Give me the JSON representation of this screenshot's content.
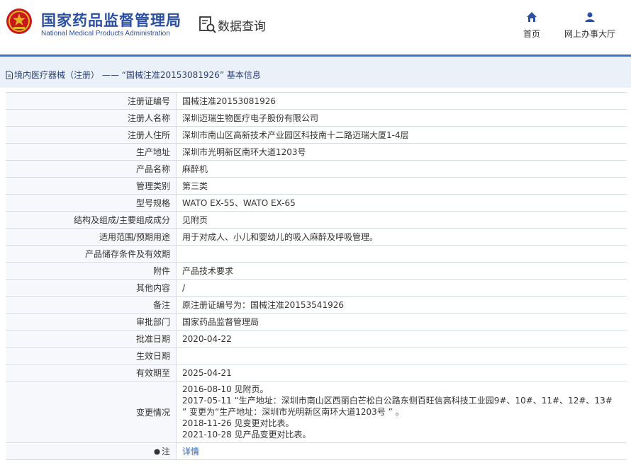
{
  "header": {
    "brand_cn": "国家药品监督管理局",
    "brand_en": "National Medical Products Administration",
    "query_title": "数据查询",
    "nav": [
      {
        "label": "首页",
        "icon": "home-icon"
      },
      {
        "label": "网上办事大厅",
        "icon": "user-icon"
      }
    ]
  },
  "breadcrumb": "境内医疗器械（注册） —— “国械注准20153081926” 基本信息",
  "fields": [
    {
      "label": "注册证编号",
      "value": "国械注准20153081926"
    },
    {
      "label": "注册人名称",
      "value": "深圳迈瑞生物医疗电子股份有限公司"
    },
    {
      "label": "注册人住所",
      "value": "深圳市南山区高新技术产业园区科技南十二路迈瑞大厦1-4层"
    },
    {
      "label": "生产地址",
      "value": "深圳市光明新区南环大道1203号"
    },
    {
      "label": "产品名称",
      "value": "麻醉机"
    },
    {
      "label": "管理类别",
      "value": "第三类"
    },
    {
      "label": "型号规格",
      "value": "WATO EX-55、WATO EX-65"
    },
    {
      "label": "结构及组成/主要组成成分",
      "value": "见附页"
    },
    {
      "label": "适用范围/预期用途",
      "value": "用于对成人、小儿和婴幼儿的吸入麻醉及呼吸管理。"
    },
    {
      "label": "产品储存条件及有效期",
      "value": ""
    },
    {
      "label": "附件",
      "value": "产品技术要求"
    },
    {
      "label": "其他内容",
      "value": "/"
    },
    {
      "label": "备注",
      "value": "原注册证编号为：国械注准20153541926"
    },
    {
      "label": "审批部门",
      "value": "国家药品监督管理局"
    },
    {
      "label": "批准日期",
      "value": "2020-04-22"
    },
    {
      "label": "生效日期",
      "value": ""
    },
    {
      "label": "有效期至",
      "value": "2025-04-21"
    }
  ],
  "change": {
    "label": "变更情况",
    "lines": [
      "2016-08-10 见附页。",
      "2017-05-11 “生产地址：深圳市南山区西丽白芒松白公路东侧百旺信高科技工业园9#、10#、11#、12#、13#",
      "” 变更为“生产地址：深圳市光明新区南环大道1203号 ” 。",
      "2018-11-26 见变更对比表。",
      "2021-10-28 见产品变更对比表。"
    ]
  },
  "note": {
    "label": "注",
    "link": "详情",
    "icon": "bullet-icon"
  },
  "colors": {
    "brand_blue": "#2b4fa3",
    "accent_line": "#3a73c8",
    "subheader_bg": "#ebf1f9",
    "label_bg": "#f6f8fb",
    "link": "#2b5fb6"
  }
}
